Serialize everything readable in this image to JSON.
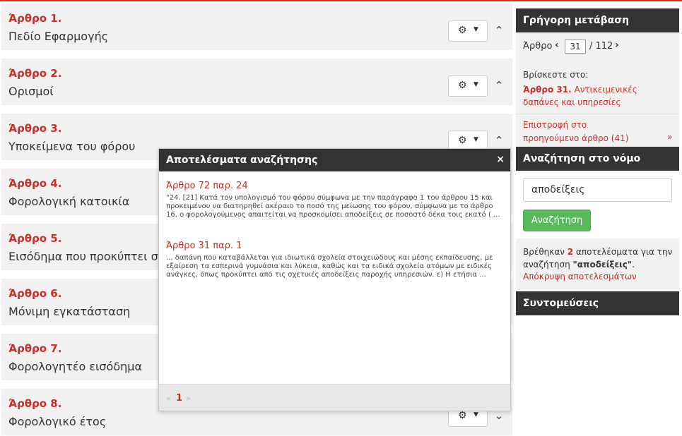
{
  "articles": [
    {
      "num": "Άρθρο 1.",
      "title": "Πεδίο Εφαρμογής"
    },
    {
      "num": "Άρθρο 2.",
      "title": "Ορισμοί"
    },
    {
      "num": "Άρθρο 3.",
      "title": "Υποκείμενα του φόρου"
    },
    {
      "num": "Άρθρο 4.",
      "title": "Φορολογική κατοικία"
    },
    {
      "num": "Άρθρο 5.",
      "title": "Εισόδημα που προκύπτει στ"
    },
    {
      "num": "Άρθρο 6.",
      "title": "Μόνιμη εγκατάσταση"
    },
    {
      "num": "Άρθρο 7.",
      "title": "Φορολογητέο εισόδημα"
    },
    {
      "num": "Άρθρο 8.",
      "title": "Φορολογικό έτος"
    }
  ],
  "article_icons": {
    "gear": "gear-icon",
    "caret": "caret-down-icon",
    "collapse": "chevron-up-icon"
  },
  "sidebar": {
    "quick_jump": {
      "title": "Γρήγορη μετάβαση",
      "label": "Άρθρο",
      "current": "31",
      "total": "/ 112",
      "prev_icon": "‹",
      "next_icon": "›"
    },
    "location": {
      "label": "Βρίσκεστε στο:",
      "article_num": "Άρθρο 31.",
      "article_title": "Αντικειμενικές δαπάνες και υπηρεσίες"
    },
    "back": {
      "text": "Επιστροφή στο προηγούμενο άρθρο (41)",
      "raquo": "»"
    },
    "search": {
      "title": "Αναζήτηση στο νόμο",
      "value": "αποδείξεις",
      "button": "Αναζήτηση",
      "found_prefix": "Βρέθηκαν",
      "found_count": "2",
      "found_mid": "αποτελέσματα για την αναζήτηση",
      "found_query": "\"αποδείξεις\"",
      "found_end": ".",
      "hide_link": "Απόκρυψη αποτελεσμάτων"
    },
    "shortcuts": {
      "title": "Συντομεύσεις"
    }
  },
  "popup": {
    "title": "Αποτελέσματα αναζήτησης",
    "close_icon": "×",
    "results": [
      {
        "title": "Άρθρο 72 παρ. 24",
        "text": "\"24. [21] Κατά τον υπολογισμό του φόρου σύμφωνα με την παράγραφο 1 του άρθρου 15 και προκειμένου να διατηρηθεί ακέραιο το ποσό της μείωσης του φόρου, σύμφωνα με το άρθρο 16, ο φορολογούμενος απαιτείται να προσκομίσει αποδείξεις σε ποσοστό δέκα τοις εκατό ( ..."
      },
      {
        "title": "Άρθρο 31 παρ. 1",
        "text": "... δαπάνη που καταβάλλεται για ιδιωτικά σχολεία στοιχειώδους και μέσης εκπαίδευσης, με εξαίρεση τα εσπερινά γυμνάσια και λύκεια, καθώς και τα ειδικά σχολεία ατόμων με ειδικές ανάγκες, όπως προκύπτει από τις σχετικές αποδείξεις παροχής υπηρεσιών. ε) Η ετήσια ..."
      }
    ],
    "pagination": {
      "prev": "«",
      "current": "1",
      "next": "»"
    }
  },
  "colors": {
    "accent": "#c9302c",
    "dark": "#333333",
    "panel": "#f1f1f1",
    "success": "#5cb85c"
  }
}
